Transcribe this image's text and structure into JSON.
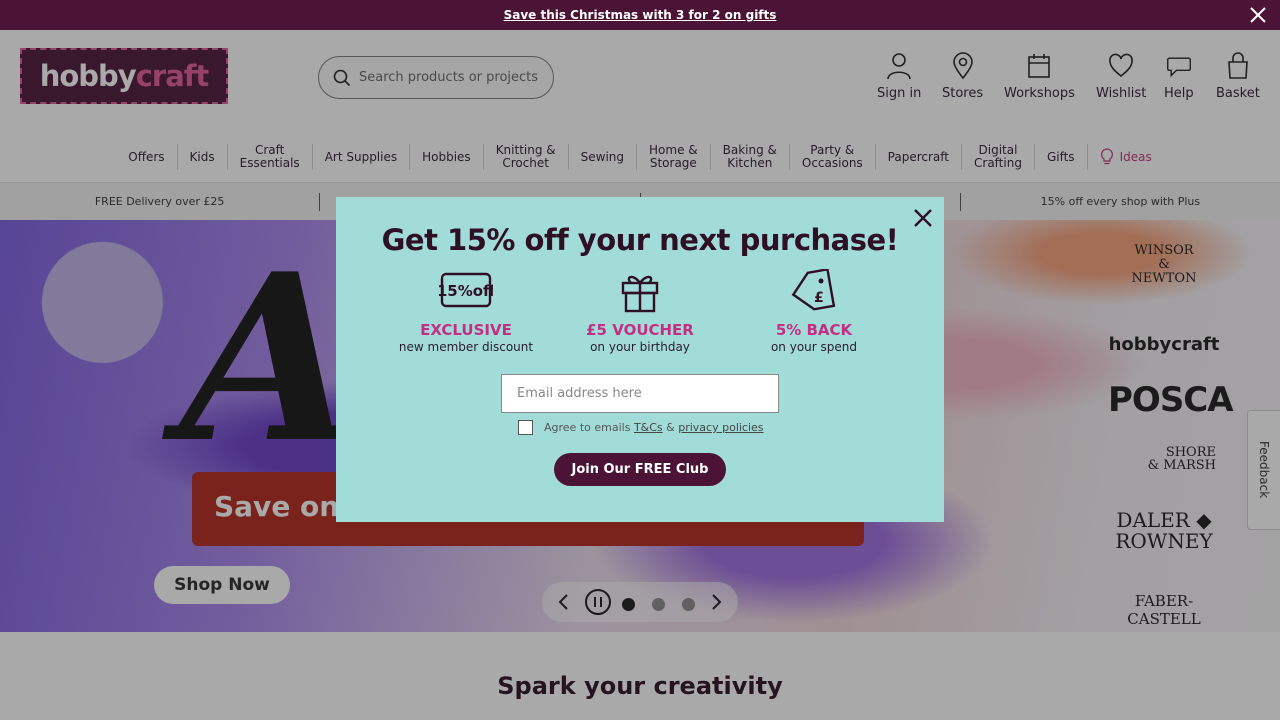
{
  "promo": {
    "text": "Save this Christmas with 3 for 2 on gifts",
    "close_icon": "close-icon"
  },
  "logo": {
    "part1": "hobby",
    "part2": "craft"
  },
  "search": {
    "placeholder": "Search products or projects"
  },
  "header_icons": [
    {
      "label": "Sign in",
      "icon": "user-icon"
    },
    {
      "label": "Stores",
      "icon": "location-pin-icon"
    },
    {
      "label": "Workshops",
      "icon": "calendar-icon"
    },
    {
      "label": "Wishlist",
      "icon": "heart-icon"
    },
    {
      "label": "Help",
      "icon": "chat-bubble-icon"
    },
    {
      "label": "Basket",
      "icon": "bag-icon"
    }
  ],
  "nav": [
    "Offers",
    "Kids",
    "Craft\nEssentials",
    "Art Supplies",
    "Hobbies",
    "Knitting &\nCrochet",
    "Sewing",
    "Home &\nStorage",
    "Baking &\nKitchen",
    "Party &\nOccasions",
    "Papercraft",
    "Digital\nCrafting",
    "Gifts",
    "Ideas"
  ],
  "usps": [
    "FREE Delivery over £25",
    "",
    "",
    "15% off every shop with Plus"
  ],
  "hero": {
    "headline_letter": "A",
    "banner_text": "Save on",
    "cta": "Shop Now",
    "brands": {
      "winsor_newton": "WINSOR\n&\nNEWTON",
      "hobbycraft": "hobbycraft",
      "posca": "POSCA",
      "shore_marsh": "SHORE\n& MARSH",
      "daler_rowney": "DALER ◆\nROWNEY",
      "faber_castell": "FABER-CASTELL"
    },
    "carousel": {
      "slides": 3,
      "active": 1
    }
  },
  "feedback": "Feedback",
  "section_title": "Spark your creativity",
  "modal": {
    "title": "Get 15% off your next purchase!",
    "benefits": [
      {
        "icon": "discount-badge-icon",
        "badge": "15%off",
        "title": "EXCLUSIVE",
        "subtitle": "new member discount"
      },
      {
        "icon": "gift-icon",
        "title": "£5 VOUCHER",
        "subtitle": "on your birthday"
      },
      {
        "icon": "price-tag-icon",
        "title": "5% BACK",
        "subtitle": "on your spend"
      }
    ],
    "email_placeholder": "Email address here",
    "agree_prefix": "Agree to emails",
    "agree_tc": "T&Cs",
    "agree_amp": "&",
    "agree_privacy": "privacy policies",
    "join_label": "Join Our FREE Club"
  },
  "colors": {
    "brand": "#4b1436",
    "accent_pink": "#c42f83",
    "modal_bg": "#a2dcd9"
  }
}
